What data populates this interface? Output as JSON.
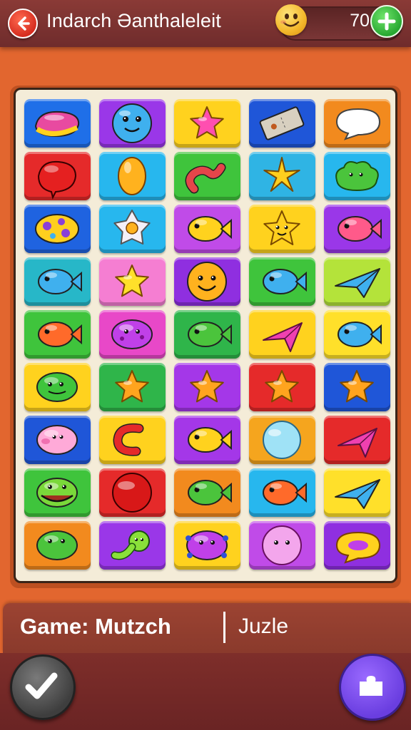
{
  "header": {
    "title": "Indarch Əanthaleleit",
    "coins": "70",
    "back_icon": "back-arrow-icon",
    "currency_icon": "smiley-coin-icon",
    "add_icon": "plus-icon"
  },
  "board": {
    "rows": 9,
    "cols": 5,
    "tiles": [
      {
        "piece": "jellybean",
        "color": "#1f6fe8"
      },
      {
        "piece": "smile-bubble",
        "color": "#9a37e8"
      },
      {
        "piece": "star",
        "color": "#ffd21e"
      },
      {
        "piece": "ticket",
        "color": "#1f56d8"
      },
      {
        "piece": "speech-bubble",
        "color": "#f28a1e"
      },
      {
        "piece": "red-blob",
        "color": "#e52a2a"
      },
      {
        "piece": "egg",
        "color": "#27b7ee"
      },
      {
        "piece": "worm",
        "color": "#3fc43c"
      },
      {
        "piece": "gold-star",
        "color": "#2fb4e4"
      },
      {
        "piece": "green-bush",
        "color": "#27b7ee"
      },
      {
        "piece": "spotted-egg",
        "color": "#1f63e0"
      },
      {
        "piece": "crystal",
        "color": "#27b7ee"
      },
      {
        "piece": "yellow-fish",
        "color": "#c04be8"
      },
      {
        "piece": "smiling-star",
        "color": "#ffd21e"
      },
      {
        "piece": "pink-fish",
        "color": "#9a37e8"
      },
      {
        "piece": "blue-fish",
        "color": "#27b7c8"
      },
      {
        "piece": "yellow-star",
        "color": "#f57ed2"
      },
      {
        "piece": "smiley",
        "color": "#8f2fe0"
      },
      {
        "piece": "blue-fish",
        "color": "#3fc43c"
      },
      {
        "piece": "paper-plane",
        "color": "#b4e33a"
      },
      {
        "piece": "orange-fish",
        "color": "#3fc43c"
      },
      {
        "piece": "purple-blob",
        "color": "#e848c8"
      },
      {
        "piece": "green-fish",
        "color": "#2fb54a"
      },
      {
        "piece": "pink-gem",
        "color": "#ffd21e"
      },
      {
        "piece": "blue-fish",
        "color": "#ffe02a"
      },
      {
        "piece": "green-jelly",
        "color": "#ffd21e"
      },
      {
        "piece": "orange-star",
        "color": "#2fb54a"
      },
      {
        "piece": "orange-star",
        "color": "#a437e8"
      },
      {
        "piece": "orange-star",
        "color": "#e52a2a"
      },
      {
        "piece": "orange-star",
        "color": "#1f56d8"
      },
      {
        "piece": "pig",
        "color": "#1f56d8"
      },
      {
        "piece": "red-hook",
        "color": "#ffd21e"
      },
      {
        "piece": "yellow-fish",
        "color": "#a437e8"
      },
      {
        "piece": "bubble",
        "color": "#f5a51e"
      },
      {
        "piece": "pink-gem",
        "color": "#e52a2a"
      },
      {
        "piece": "frog",
        "color": "#3fc43c"
      },
      {
        "piece": "red-ball",
        "color": "#e52a2a"
      },
      {
        "piece": "green-fish",
        "color": "#f28a1e"
      },
      {
        "piece": "orange-fish",
        "color": "#27b7ee"
      },
      {
        "piece": "paper-plane",
        "color": "#ffe02a"
      },
      {
        "piece": "green-frog",
        "color": "#f28a1e"
      },
      {
        "piece": "green-tadpole",
        "color": "#9a37e8"
      },
      {
        "piece": "purple-virus",
        "color": "#ffd21e"
      },
      {
        "piece": "pink-ghost",
        "color": "#c04be8"
      },
      {
        "piece": "donut-bubble",
        "color": "#8f2fe0"
      }
    ]
  },
  "footer": {
    "game_label": "Game: Mutzch",
    "mode_label": "Juzle",
    "left_button_icon": "check-icon",
    "right_button_icon": "puzzle-icon"
  }
}
